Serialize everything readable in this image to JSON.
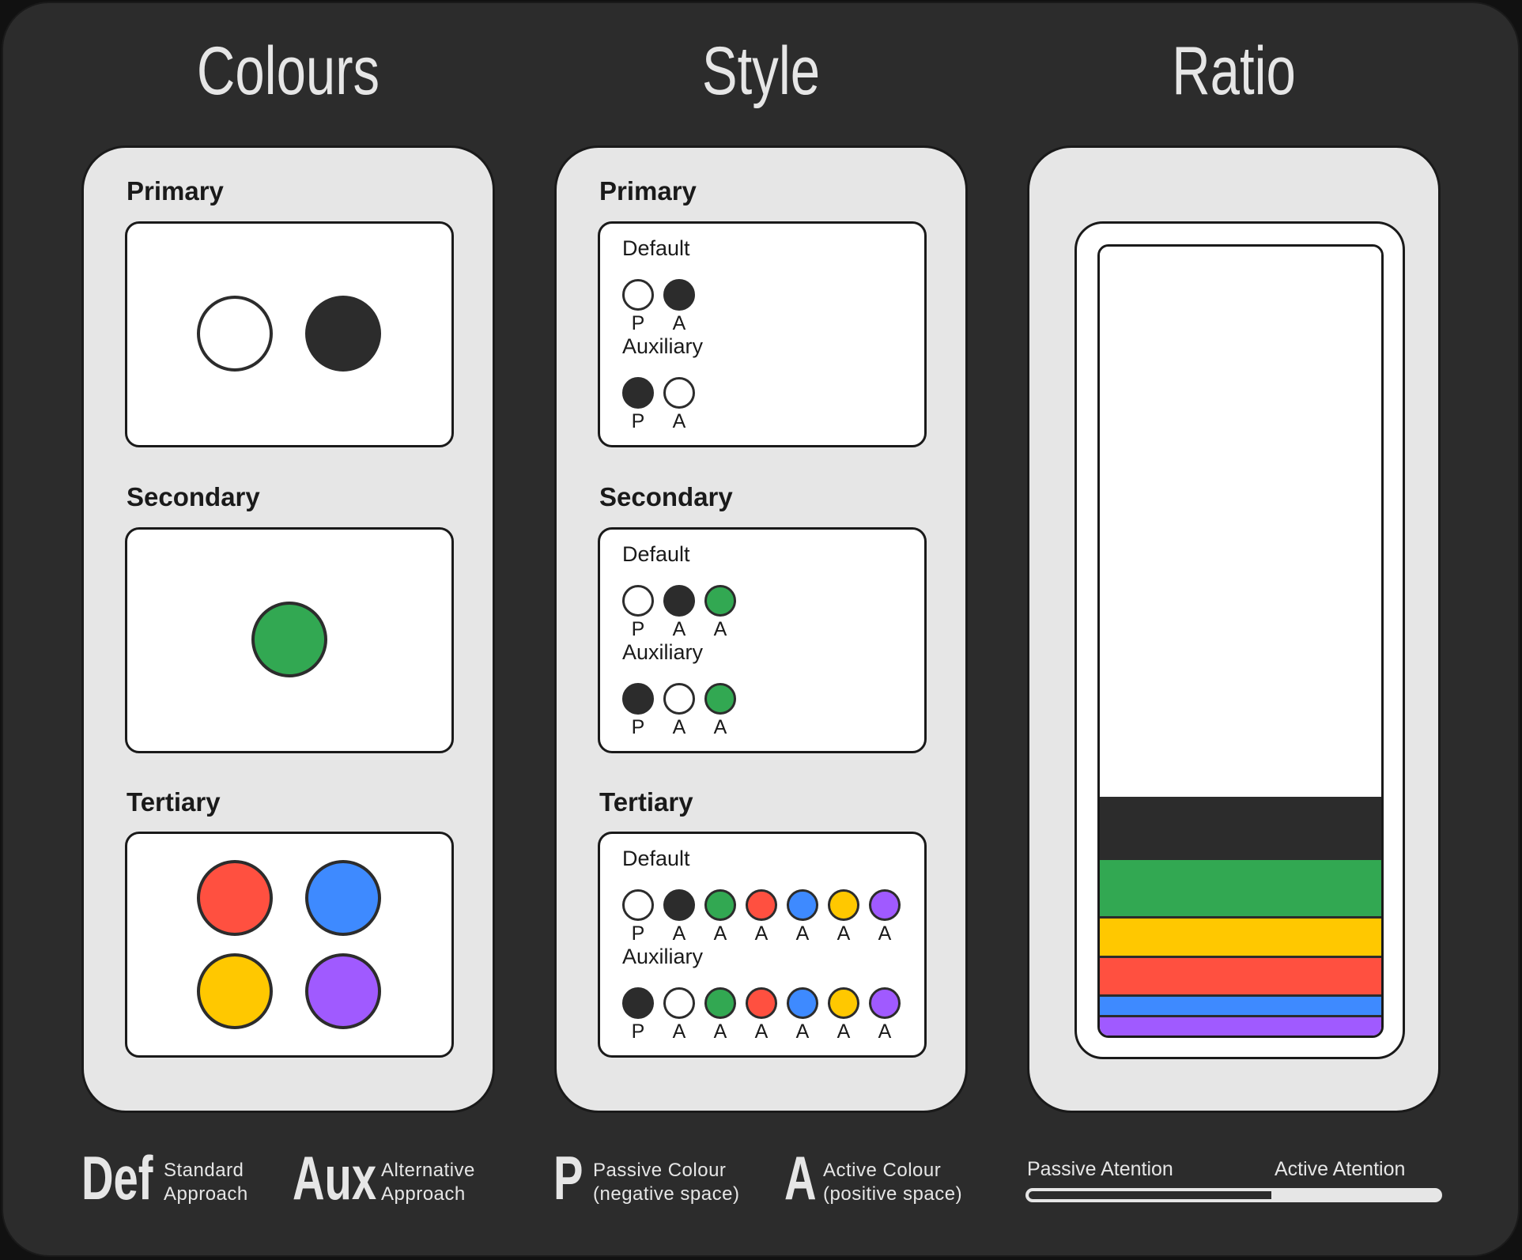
{
  "colors": {
    "white": "#ffffff",
    "black": "#2c2c2c",
    "green": "#32a852",
    "red": "#ff5040",
    "blue": "#3e8aff",
    "yellow": "#ffc800",
    "purple": "#a05aff"
  },
  "columns": {
    "colours": "Colours",
    "style": "Style",
    "ratio": "Ratio"
  },
  "sections": {
    "primary": "Primary",
    "secondary": "Secondary",
    "tertiary": "Tertiary"
  },
  "rows": {
    "default": "Default",
    "auxiliary": "Auxiliary"
  },
  "colours_panel": {
    "primary": [
      "white",
      "black"
    ],
    "secondary": [
      "green"
    ],
    "tertiary": [
      "red",
      "blue",
      "yellow",
      "purple"
    ]
  },
  "style_panel": {
    "primary": {
      "default": [
        {
          "c": "white",
          "l": "P"
        },
        {
          "c": "black",
          "l": "A"
        }
      ],
      "auxiliary": [
        {
          "c": "black",
          "l": "P"
        },
        {
          "c": "white",
          "l": "A"
        }
      ]
    },
    "secondary": {
      "default": [
        {
          "c": "white",
          "l": "P"
        },
        {
          "c": "black",
          "l": "A"
        },
        {
          "c": "green",
          "l": "A"
        }
      ],
      "auxiliary": [
        {
          "c": "black",
          "l": "P"
        },
        {
          "c": "white",
          "l": "A"
        },
        {
          "c": "green",
          "l": "A"
        }
      ]
    },
    "tertiary": {
      "default": [
        {
          "c": "white",
          "l": "P"
        },
        {
          "c": "black",
          "l": "A"
        },
        {
          "c": "green",
          "l": "A"
        },
        {
          "c": "red",
          "l": "A"
        },
        {
          "c": "blue",
          "l": "A"
        },
        {
          "c": "yellow",
          "l": "A"
        },
        {
          "c": "purple",
          "l": "A"
        }
      ],
      "auxiliary": [
        {
          "c": "black",
          "l": "P"
        },
        {
          "c": "white",
          "l": "A"
        },
        {
          "c": "green",
          "l": "A"
        },
        {
          "c": "red",
          "l": "A"
        },
        {
          "c": "blue",
          "l": "A"
        },
        {
          "c": "yellow",
          "l": "A"
        },
        {
          "c": "purple",
          "l": "A"
        }
      ]
    }
  },
  "ratio_panel": {
    "bands": [
      {
        "color": "white",
        "share": 69.7
      },
      {
        "color": "black",
        "share": 7.8
      },
      {
        "color": "green",
        "share": 7.4
      },
      {
        "color": "yellow",
        "share": 5.0
      },
      {
        "color": "red",
        "share": 4.9
      },
      {
        "color": "blue",
        "share": 2.6
      },
      {
        "color": "purple",
        "share": 2.6
      }
    ]
  },
  "legend": {
    "def": {
      "abbr": "Def",
      "line1": "Standard",
      "line2": "Approach"
    },
    "aux": {
      "abbr": "Aux",
      "line1": "Alternative",
      "line2": "Approach"
    },
    "p": {
      "abbr": "P",
      "line1": "Passive Colour",
      "line2": "(negative space)"
    },
    "a": {
      "abbr": "A",
      "line1": "Active Colour",
      "line2": "(positive space)"
    },
    "attention": {
      "passive": "Passive  Atention",
      "active": "Active Atention",
      "passive_fraction": 0.59
    }
  }
}
